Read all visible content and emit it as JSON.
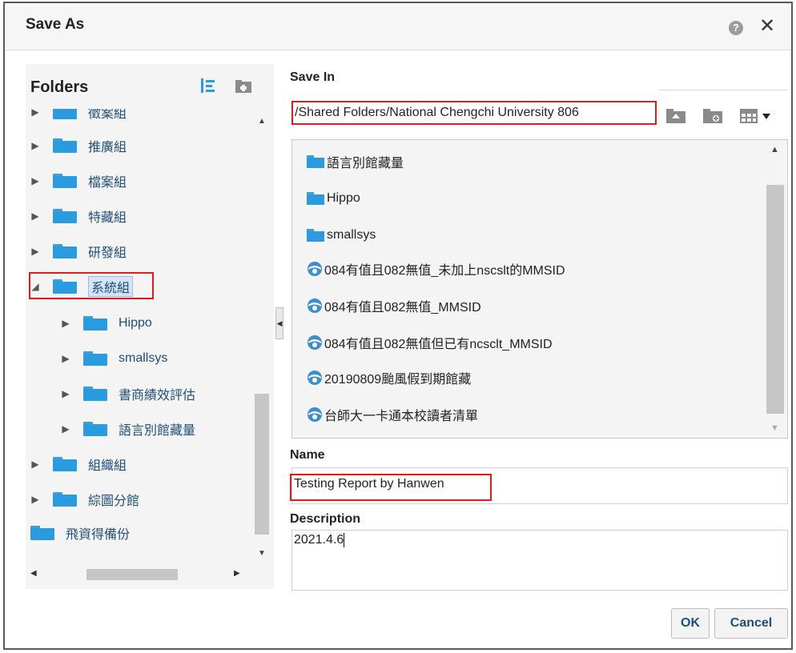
{
  "dialog": {
    "title": "Save As",
    "help_glyph": "?",
    "close_glyph": "✕"
  },
  "folders": {
    "heading": "Folders",
    "items": [
      {
        "label": "徵案組",
        "expanded": false
      },
      {
        "label": "推廣組",
        "expanded": false
      },
      {
        "label": "檔案組",
        "expanded": false
      },
      {
        "label": "特藏組",
        "expanded": false
      },
      {
        "label": "研發組",
        "expanded": false
      },
      {
        "label": "系統組",
        "expanded": true,
        "selected": true
      },
      {
        "label": "Hippo",
        "expanded": false,
        "child": true
      },
      {
        "label": "smallsys",
        "expanded": false,
        "child": true
      },
      {
        "label": "書商績效評估",
        "expanded": false,
        "child": true
      },
      {
        "label": "語言別館藏量",
        "expanded": false,
        "child": true
      },
      {
        "label": "組織組",
        "expanded": false
      },
      {
        "label": "綜圖分館",
        "expanded": false
      },
      {
        "label": "飛資得備份",
        "expanded": false
      }
    ]
  },
  "save_in": {
    "label": "Save In",
    "path": "/Shared Folders/National Chengchi University 806"
  },
  "file_list": {
    "items": [
      {
        "label": "語言別館藏量",
        "kind": "folder"
      },
      {
        "label": "Hippo",
        "kind": "folder"
      },
      {
        "label": "smallsys",
        "kind": "folder"
      },
      {
        "label": "084有值且082無值_未加上nscslt的MMSID",
        "kind": "report"
      },
      {
        "label": "084有值且082無值_MMSID",
        "kind": "report"
      },
      {
        "label": "084有值且082無值但已有ncsclt_MMSID",
        "kind": "report"
      },
      {
        "label": "20190809颱風假到期館藏",
        "kind": "report"
      },
      {
        "label": "台師大一卡通本校讀者清單",
        "kind": "report"
      }
    ]
  },
  "name_field": {
    "label": "Name",
    "value": "Testing Report by Hanwen"
  },
  "description_field": {
    "label": "Description",
    "value": "2021.4.6"
  },
  "buttons": {
    "ok": "OK",
    "cancel": "Cancel"
  },
  "colors": {
    "folder": "#2b9be0",
    "highlight": "#e01b24",
    "link_text": "#1f4e79"
  }
}
